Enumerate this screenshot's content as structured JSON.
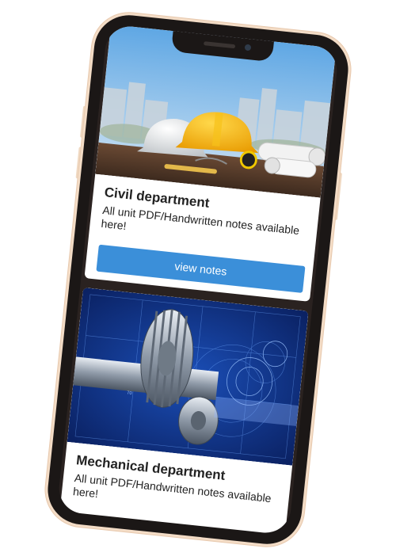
{
  "cards": [
    {
      "title": "Civil department",
      "description": "All unit PDF/Handwritten notes available here!",
      "button_label": "view notes",
      "image": "hard-hats-and-blueprints-photo"
    },
    {
      "title": "Mechanical department",
      "description": "All unit PDF/Handwritten notes available here!",
      "image": "gear-blueprint-render",
      "image_label": "70"
    }
  ],
  "colors": {
    "button": "#3b8fd9",
    "frame": "#1b1716",
    "frame_edge": "#f3dcc6"
  }
}
